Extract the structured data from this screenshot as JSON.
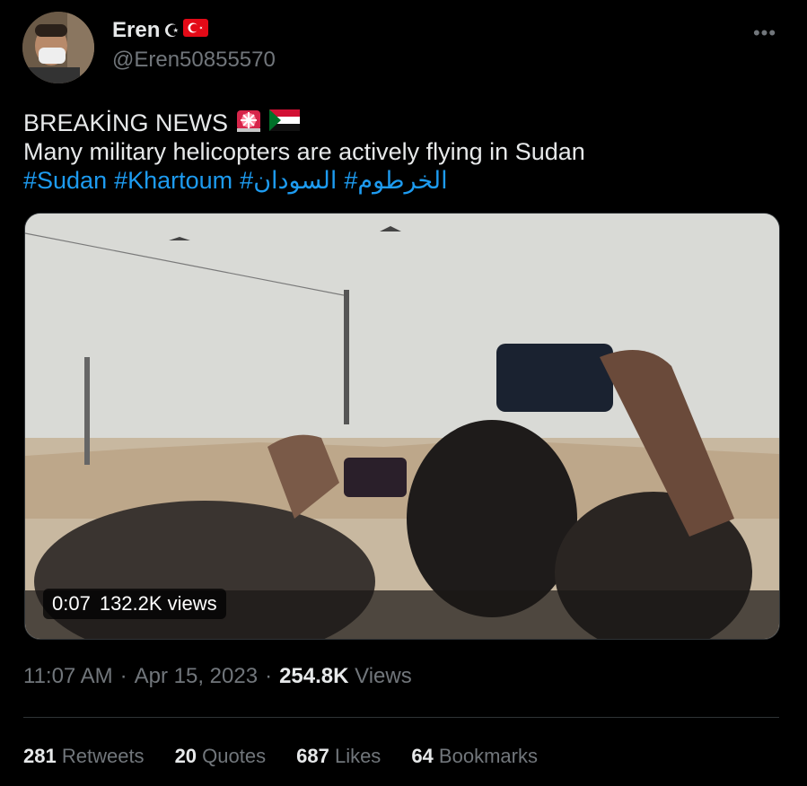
{
  "author": {
    "name": "Eren",
    "handle": "@Eren50855570"
  },
  "icons": {
    "crescent": "crescent-moon-icon",
    "flag_turkey": "turkey-flag-icon",
    "siren": "rotating-light-icon",
    "flag_sudan": "sudan-flag-icon",
    "more": "more-icon"
  },
  "more_label": "•••",
  "tweet": {
    "line1": "BREAKİNG NEWS",
    "line2": "Many military helicopters are actively flying in Sudan",
    "hashtags": [
      "#Sudan",
      "#Khartoum",
      "#السودان",
      "#الخرطوم"
    ]
  },
  "video": {
    "time": "0:07",
    "views": "132.2K views"
  },
  "meta": {
    "time": "11:07 AM",
    "sep1": "·",
    "date": "Apr 15, 2023",
    "sep2": "·",
    "views_count": "254.8K",
    "views_label": "Views"
  },
  "stats": [
    {
      "count": "281",
      "label": "Retweets"
    },
    {
      "count": "20",
      "label": "Quotes"
    },
    {
      "count": "687",
      "label": "Likes"
    },
    {
      "count": "64",
      "label": "Bookmarks"
    }
  ],
  "colors": {
    "background": "#000000",
    "text": "#e7e9ea",
    "secondary": "#71767b",
    "link": "#1d9bf0",
    "turkey_red": "#e30a17"
  }
}
